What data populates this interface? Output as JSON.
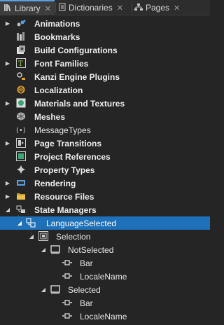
{
  "tabs": [
    {
      "label": "Library",
      "active": true,
      "icon": "library-icon"
    },
    {
      "label": "Dictionaries",
      "active": false,
      "icon": "dictionary-icon"
    },
    {
      "label": "Pages",
      "active": false,
      "icon": "pages-icon"
    }
  ],
  "tree": [
    {
      "label": "Animations",
      "icon": "animations-icon",
      "expandable": true,
      "bold": true
    },
    {
      "label": "Bookmarks",
      "icon": "bookmarks-icon",
      "expandable": false,
      "bold": true
    },
    {
      "label": "Build Configurations",
      "icon": "build-config-icon",
      "expandable": false,
      "bold": true
    },
    {
      "label": "Font Families",
      "icon": "font-icon",
      "expandable": true,
      "bold": true
    },
    {
      "label": "Kanzi Engine Plugins",
      "icon": "plugin-icon",
      "expandable": false,
      "bold": true
    },
    {
      "label": "Localization",
      "icon": "localization-icon",
      "expandable": false,
      "bold": true
    },
    {
      "label": "Materials and Textures",
      "icon": "materials-icon",
      "expandable": true,
      "bold": true
    },
    {
      "label": "Meshes",
      "icon": "meshes-icon",
      "expandable": false,
      "bold": true
    },
    {
      "label": "MessageTypes",
      "icon": "message-icon",
      "expandable": false,
      "bold": false
    },
    {
      "label": "Page Transitions",
      "icon": "transitions-icon",
      "expandable": true,
      "bold": true
    },
    {
      "label": "Project References",
      "icon": "references-icon",
      "expandable": false,
      "bold": true
    },
    {
      "label": "Property Types",
      "icon": "property-icon",
      "expandable": false,
      "bold": true
    },
    {
      "label": "Rendering",
      "icon": "rendering-icon",
      "expandable": true,
      "bold": true
    },
    {
      "label": "Resource Files",
      "icon": "folder-icon",
      "expandable": true,
      "bold": true
    },
    {
      "label": "State Managers",
      "icon": "state-managers-icon",
      "expandable": false,
      "expanded": true,
      "bold": true
    },
    {
      "label": "LanguageSelected",
      "icon": "state-manager-icon",
      "expanded": true,
      "selected": true,
      "bold": false
    },
    {
      "label": "Selection",
      "icon": "state-group-icon",
      "expanded": true,
      "bold": false
    },
    {
      "label": "NotSelected",
      "icon": "state-icon",
      "expanded": true,
      "bold": false
    },
    {
      "label": "Bar",
      "icon": "property-target-icon",
      "bold": false
    },
    {
      "label": "LocaleName",
      "icon": "property-target-icon",
      "bold": false
    },
    {
      "label": "Selected",
      "icon": "state-icon",
      "expanded": true,
      "bold": false
    },
    {
      "label": "Bar",
      "icon": "property-target-icon",
      "bold": false
    },
    {
      "label": "LocaleName",
      "icon": "property-target-icon",
      "bold": false
    }
  ]
}
